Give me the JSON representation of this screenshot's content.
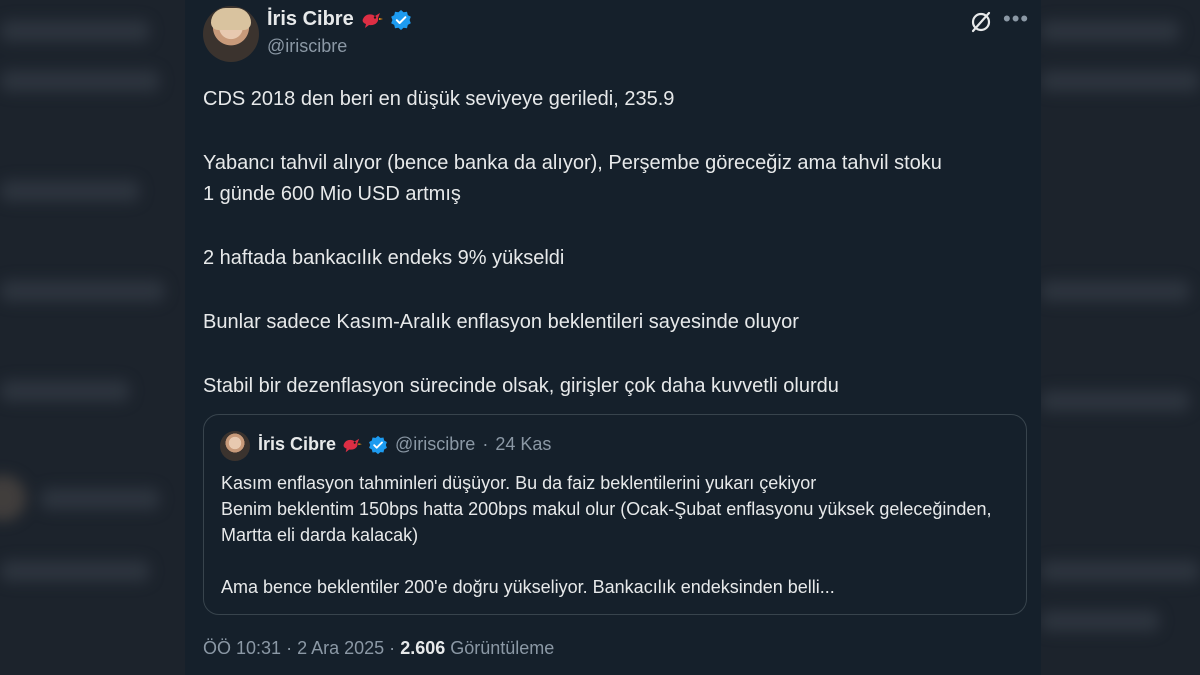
{
  "tweet": {
    "author_name": "İris Cibre",
    "author_handle": "@iriscibre",
    "paragraphs": [
      "CDS 2018 den beri en düşük seviyeye geriledi, 235.9",
      "Yabancı tahvil alıyor (bence banka da alıyor), Perşembe göreceğiz ama tahvil stoku\n1 günde 600 Mio USD artmış",
      "2 haftada bankacılık endeks 9% yükseldi",
      "Bunlar sadece Kasım-Aralık enflasyon beklentileri sayesinde oluyor",
      "Stabil bir dezenflasyon sürecinde olsak, girişler çok daha kuvvetli olurdu"
    ],
    "time": "ÖÖ 10:31",
    "date": "2 Ara 2025",
    "views_count": "2.606",
    "views_label": "Görüntüleme"
  },
  "quoted": {
    "author_name": "İris Cibre",
    "author_handle": "@iriscibre",
    "date": "24 Kas",
    "lines": [
      "Kasım enflasyon tahminleri düşüyor. Bu da faiz beklentilerini yukarı çekiyor",
      "Benim beklentim 150bps hatta 200bps makul olur (Ocak-Şubat enflasyonu yüksek geleceğinden, Martta eli darda kalacak)",
      "Ama bence beklentiler 200'e doğru yükseliyor. Bankacılık endeksinden belli..."
    ]
  },
  "icons": {
    "verified": "verified-badge-icon",
    "emoji": "red-bird-icon",
    "grok": "grok-icon",
    "more": "more-options-icon"
  },
  "colors": {
    "card_bg": "#15202b",
    "text": "#e7e9ea",
    "muted": "#8b98a5",
    "verified": "#1d9bf0",
    "border": "#38444d"
  },
  "separator": "·"
}
